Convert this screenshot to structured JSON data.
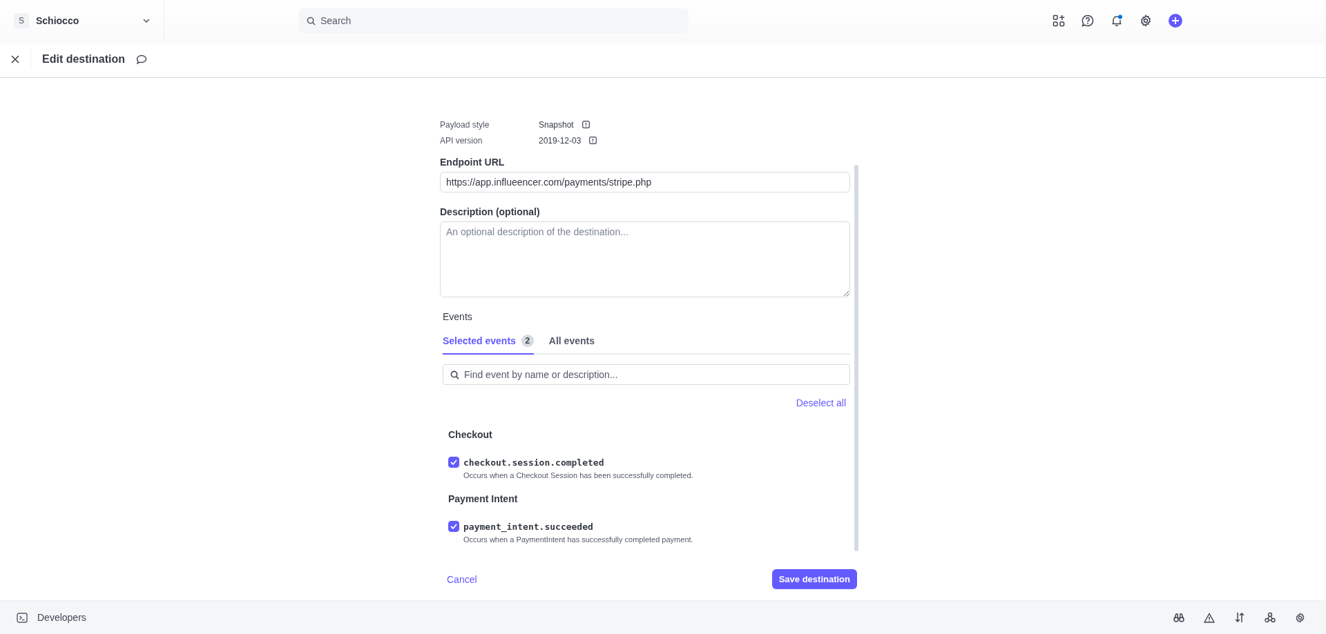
{
  "account": {
    "initial": "S",
    "name": "Schiocco"
  },
  "search": {
    "placeholder": "Search"
  },
  "notifications": {
    "unread": true
  },
  "page": {
    "title": "Edit destination"
  },
  "settings": [
    {
      "label": "Payload style",
      "value": "Snapshot"
    },
    {
      "label": "API version",
      "value": "2019-12-03"
    }
  ],
  "endpoint": {
    "label": "Endpoint URL",
    "value": "https://app.influeencer.com/payments/stripe.php"
  },
  "description": {
    "label": "Description (optional)",
    "placeholder": "An optional description of the destination..."
  },
  "events": {
    "title": "Events",
    "tabs": [
      {
        "label": "Selected events",
        "count": "2",
        "selected": true
      },
      {
        "label": "All events",
        "selected": false
      }
    ],
    "search": {
      "placeholder": "Find event by name or description..."
    },
    "deselect": "Deselect all",
    "groups": [
      {
        "name": "Checkout",
        "items": [
          {
            "name": "checkout.session.completed",
            "description": "Occurs when a Checkout Session has been successfully completed.",
            "checked": true
          }
        ]
      },
      {
        "name": "Payment Intent",
        "items": [
          {
            "name": "payment_intent.succeeded",
            "description": "Occurs when a PaymentIntent has successfully completed payment.",
            "checked": true
          }
        ]
      }
    ]
  },
  "actions": {
    "cancel": "Cancel",
    "save": "Save destination"
  },
  "footer": {
    "label": "Developers"
  }
}
